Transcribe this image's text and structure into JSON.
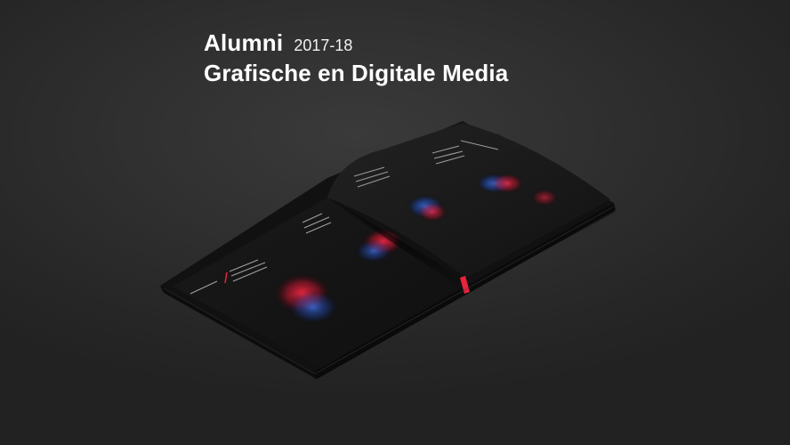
{
  "header": {
    "title": "Alumni",
    "year": "2017-18",
    "subtitle": "Grafische en Digitale Media"
  },
  "image": {
    "subject": "open-book-mockup",
    "colors": {
      "background": "#2b2b2b",
      "page": "#141414",
      "accent_red": "#e8233b",
      "accent_blue": "#2f6fe0"
    }
  }
}
